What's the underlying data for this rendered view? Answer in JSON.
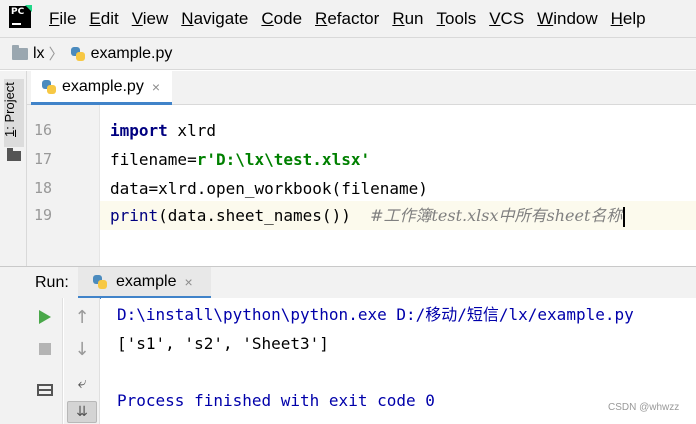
{
  "menubar": {
    "logo_text": "PC",
    "items": [
      {
        "mnemonic": "F",
        "rest": "ile"
      },
      {
        "mnemonic": "E",
        "rest": "dit"
      },
      {
        "mnemonic": "V",
        "rest": "iew"
      },
      {
        "mnemonic": "N",
        "rest": "avigate"
      },
      {
        "mnemonic": "C",
        "rest": "ode"
      },
      {
        "mnemonic": "R",
        "rest": "efactor"
      },
      {
        "mnemonic": "R",
        "rest": "un"
      },
      {
        "mnemonic": "T",
        "rest": "ools"
      },
      {
        "mnemonic": "V",
        "rest": "CS"
      },
      {
        "mnemonic": "W",
        "rest": "indow"
      },
      {
        "mnemonic": "H",
        "rest": "elp"
      }
    ]
  },
  "breadcrumb": {
    "project": "lx",
    "file": "example.py"
  },
  "left_strip": {
    "project_mnemonic": "1",
    "project_rest": ": Project"
  },
  "editor_tab": {
    "label": "example.py",
    "close": "×"
  },
  "code": {
    "lines": [
      {
        "num": "16",
        "kw": "import",
        "rest": " xlrd"
      },
      {
        "num": "17",
        "a": "filename=",
        "b": "r'D:\\lx\\test.xlsx'"
      },
      {
        "num": "18",
        "a": "data=xlrd.open_workbook(filename)"
      },
      {
        "num": "19",
        "kw": "print",
        "rest": "(data.sheet_names())  ",
        "comment": "#工作簿test.xlsx中所有sheet名称"
      }
    ]
  },
  "run_panel": {
    "title": "Run:",
    "tab_label": "example",
    "tab_close": "×",
    "console_lines": [
      "D:\\install\\python\\python.exe D:/移动/短信/lx/example.py",
      "['s1', 's2', 'Sheet3']",
      "",
      "Process finished with exit code 0"
    ]
  },
  "watermark": "CSDN @whwzz",
  "colors": {
    "keyword": "#000080",
    "string": "#008000",
    "comment": "#808080",
    "run_green": "#4aa84a",
    "tab_underline": "#4083c9"
  },
  "icons": [
    "pycharm-logo",
    "folder-icon",
    "python-file-icon",
    "run-icon",
    "stop-icon",
    "arrow-up-icon",
    "arrow-down-icon",
    "soft-wrap-icon",
    "scroll-to-end-icon",
    "layout-icon"
  ]
}
